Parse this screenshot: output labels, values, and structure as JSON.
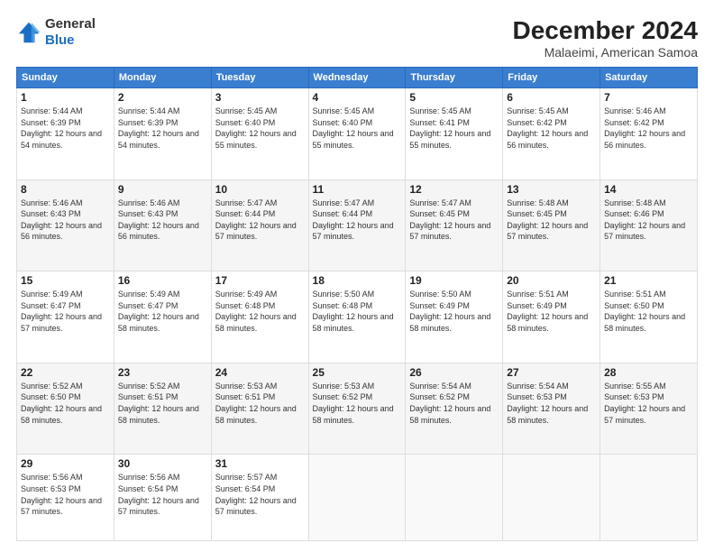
{
  "logo": {
    "line1": "General",
    "line2": "Blue"
  },
  "header": {
    "month": "December 2024",
    "location": "Malaeimi, American Samoa"
  },
  "weekdays": [
    "Sunday",
    "Monday",
    "Tuesday",
    "Wednesday",
    "Thursday",
    "Friday",
    "Saturday"
  ],
  "weeks": [
    [
      {
        "day": "1",
        "sunrise": "5:44 AM",
        "sunset": "6:39 PM",
        "daylight": "12 hours and 54 minutes."
      },
      {
        "day": "2",
        "sunrise": "5:44 AM",
        "sunset": "6:39 PM",
        "daylight": "12 hours and 54 minutes."
      },
      {
        "day": "3",
        "sunrise": "5:45 AM",
        "sunset": "6:40 PM",
        "daylight": "12 hours and 55 minutes."
      },
      {
        "day": "4",
        "sunrise": "5:45 AM",
        "sunset": "6:40 PM",
        "daylight": "12 hours and 55 minutes."
      },
      {
        "day": "5",
        "sunrise": "5:45 AM",
        "sunset": "6:41 PM",
        "daylight": "12 hours and 55 minutes."
      },
      {
        "day": "6",
        "sunrise": "5:45 AM",
        "sunset": "6:42 PM",
        "daylight": "12 hours and 56 minutes."
      },
      {
        "day": "7",
        "sunrise": "5:46 AM",
        "sunset": "6:42 PM",
        "daylight": "12 hours and 56 minutes."
      }
    ],
    [
      {
        "day": "8",
        "sunrise": "5:46 AM",
        "sunset": "6:43 PM",
        "daylight": "12 hours and 56 minutes."
      },
      {
        "day": "9",
        "sunrise": "5:46 AM",
        "sunset": "6:43 PM",
        "daylight": "12 hours and 56 minutes."
      },
      {
        "day": "10",
        "sunrise": "5:47 AM",
        "sunset": "6:44 PM",
        "daylight": "12 hours and 57 minutes."
      },
      {
        "day": "11",
        "sunrise": "5:47 AM",
        "sunset": "6:44 PM",
        "daylight": "12 hours and 57 minutes."
      },
      {
        "day": "12",
        "sunrise": "5:47 AM",
        "sunset": "6:45 PM",
        "daylight": "12 hours and 57 minutes."
      },
      {
        "day": "13",
        "sunrise": "5:48 AM",
        "sunset": "6:45 PM",
        "daylight": "12 hours and 57 minutes."
      },
      {
        "day": "14",
        "sunrise": "5:48 AM",
        "sunset": "6:46 PM",
        "daylight": "12 hours and 57 minutes."
      }
    ],
    [
      {
        "day": "15",
        "sunrise": "5:49 AM",
        "sunset": "6:47 PM",
        "daylight": "12 hours and 57 minutes."
      },
      {
        "day": "16",
        "sunrise": "5:49 AM",
        "sunset": "6:47 PM",
        "daylight": "12 hours and 58 minutes."
      },
      {
        "day": "17",
        "sunrise": "5:49 AM",
        "sunset": "6:48 PM",
        "daylight": "12 hours and 58 minutes."
      },
      {
        "day": "18",
        "sunrise": "5:50 AM",
        "sunset": "6:48 PM",
        "daylight": "12 hours and 58 minutes."
      },
      {
        "day": "19",
        "sunrise": "5:50 AM",
        "sunset": "6:49 PM",
        "daylight": "12 hours and 58 minutes."
      },
      {
        "day": "20",
        "sunrise": "5:51 AM",
        "sunset": "6:49 PM",
        "daylight": "12 hours and 58 minutes."
      },
      {
        "day": "21",
        "sunrise": "5:51 AM",
        "sunset": "6:50 PM",
        "daylight": "12 hours and 58 minutes."
      }
    ],
    [
      {
        "day": "22",
        "sunrise": "5:52 AM",
        "sunset": "6:50 PM",
        "daylight": "12 hours and 58 minutes."
      },
      {
        "day": "23",
        "sunrise": "5:52 AM",
        "sunset": "6:51 PM",
        "daylight": "12 hours and 58 minutes."
      },
      {
        "day": "24",
        "sunrise": "5:53 AM",
        "sunset": "6:51 PM",
        "daylight": "12 hours and 58 minutes."
      },
      {
        "day": "25",
        "sunrise": "5:53 AM",
        "sunset": "6:52 PM",
        "daylight": "12 hours and 58 minutes."
      },
      {
        "day": "26",
        "sunrise": "5:54 AM",
        "sunset": "6:52 PM",
        "daylight": "12 hours and 58 minutes."
      },
      {
        "day": "27",
        "sunrise": "5:54 AM",
        "sunset": "6:53 PM",
        "daylight": "12 hours and 58 minutes."
      },
      {
        "day": "28",
        "sunrise": "5:55 AM",
        "sunset": "6:53 PM",
        "daylight": "12 hours and 57 minutes."
      }
    ],
    [
      {
        "day": "29",
        "sunrise": "5:56 AM",
        "sunset": "6:53 PM",
        "daylight": "12 hours and 57 minutes."
      },
      {
        "day": "30",
        "sunrise": "5:56 AM",
        "sunset": "6:54 PM",
        "daylight": "12 hours and 57 minutes."
      },
      {
        "day": "31",
        "sunrise": "5:57 AM",
        "sunset": "6:54 PM",
        "daylight": "12 hours and 57 minutes."
      },
      null,
      null,
      null,
      null
    ]
  ]
}
